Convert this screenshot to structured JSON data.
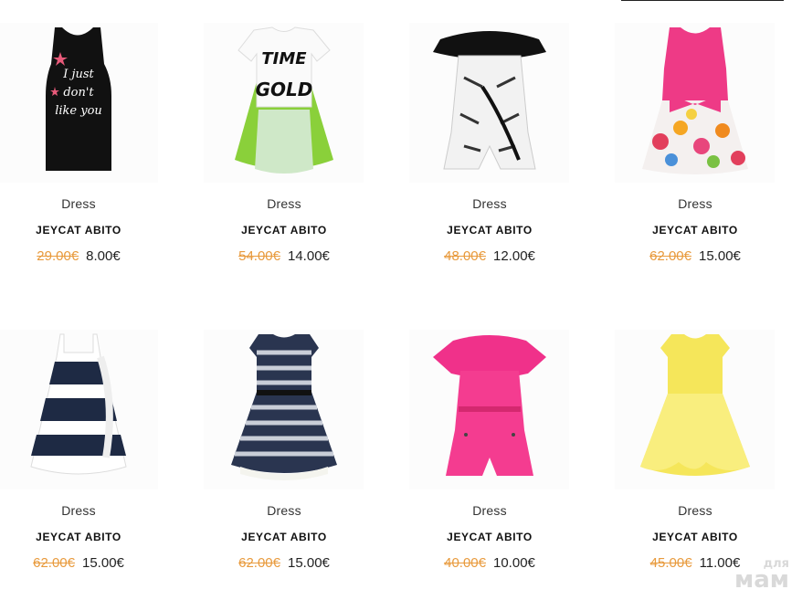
{
  "colors": {
    "accent_old_price": "#e89a3c",
    "text": "#222222",
    "watermark": "#d9d9d9"
  },
  "products": [
    {
      "image_icon": "black-tank-dress-icon",
      "category": "Dress",
      "brand": "JEYCAT ABITO",
      "old_price": "29.00€",
      "new_price": "8.00€"
    },
    {
      "image_icon": "time-is-gold-dress-icon",
      "category": "Dress",
      "brand": "JEYCAT ABITO",
      "old_price": "54.00€",
      "new_price": "14.00€"
    },
    {
      "image_icon": "zebra-romper-icon",
      "category": "Dress",
      "brand": "JEYCAT ABITO",
      "old_price": "48.00€",
      "new_price": "12.00€"
    },
    {
      "image_icon": "pink-floral-dress-icon",
      "category": "Dress",
      "brand": "JEYCAT ABITO",
      "old_price": "62.00€",
      "new_price": "15.00€"
    },
    {
      "image_icon": "striped-ruffle-dress-icon",
      "category": "Dress",
      "brand": "JEYCAT ABITO",
      "old_price": "62.00€",
      "new_price": "15.00€"
    },
    {
      "image_icon": "navy-striped-dress-icon",
      "category": "Dress",
      "brand": "JEYCAT ABITO",
      "old_price": "62.00€",
      "new_price": "15.00€"
    },
    {
      "image_icon": "pink-romper-icon",
      "category": "Dress",
      "brand": "JEYCAT ABITO",
      "old_price": "40.00€",
      "new_price": "10.00€"
    },
    {
      "image_icon": "yellow-dress-icon",
      "category": "Dress",
      "brand": "JEYCAT ABITO",
      "old_price": "45.00€",
      "new_price": "11.00€"
    }
  ],
  "watermark": {
    "line1": "для",
    "line2": "мам"
  }
}
